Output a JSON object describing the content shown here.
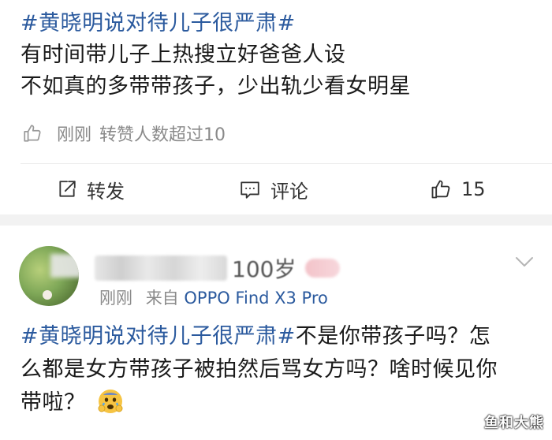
{
  "post1": {
    "hashtag": "#黄晓明说对待儿子很严肃#",
    "line2": "有时间带儿子上热搜立好爸爸人设",
    "line3": "不如真的多带带孩子，少出轨少看女明星",
    "like_info": {
      "time": "刚刚",
      "text": "转赞人数超过10"
    },
    "actions": {
      "forward_label": "转发",
      "comment_label": "评论",
      "like_count": "15"
    }
  },
  "post2": {
    "username_tail": "100岁",
    "meta": {
      "time": "刚刚",
      "from": "来自",
      "device": "OPPO Find X3 Pro"
    },
    "content": {
      "hashtag": "#黄晓明说对待儿子很严肃#",
      "line1_rest": "不是你带孩子吗？怎",
      "line2": "么都是女方带孩子被拍然后骂女方吗？啥时候见你",
      "line3": "带啦？"
    }
  },
  "watermark": "鱼和大熊",
  "colors": {
    "link_blue": "#2b5a9e",
    "muted_gray": "#8a8a8a",
    "separator": "#f2f2f2"
  }
}
